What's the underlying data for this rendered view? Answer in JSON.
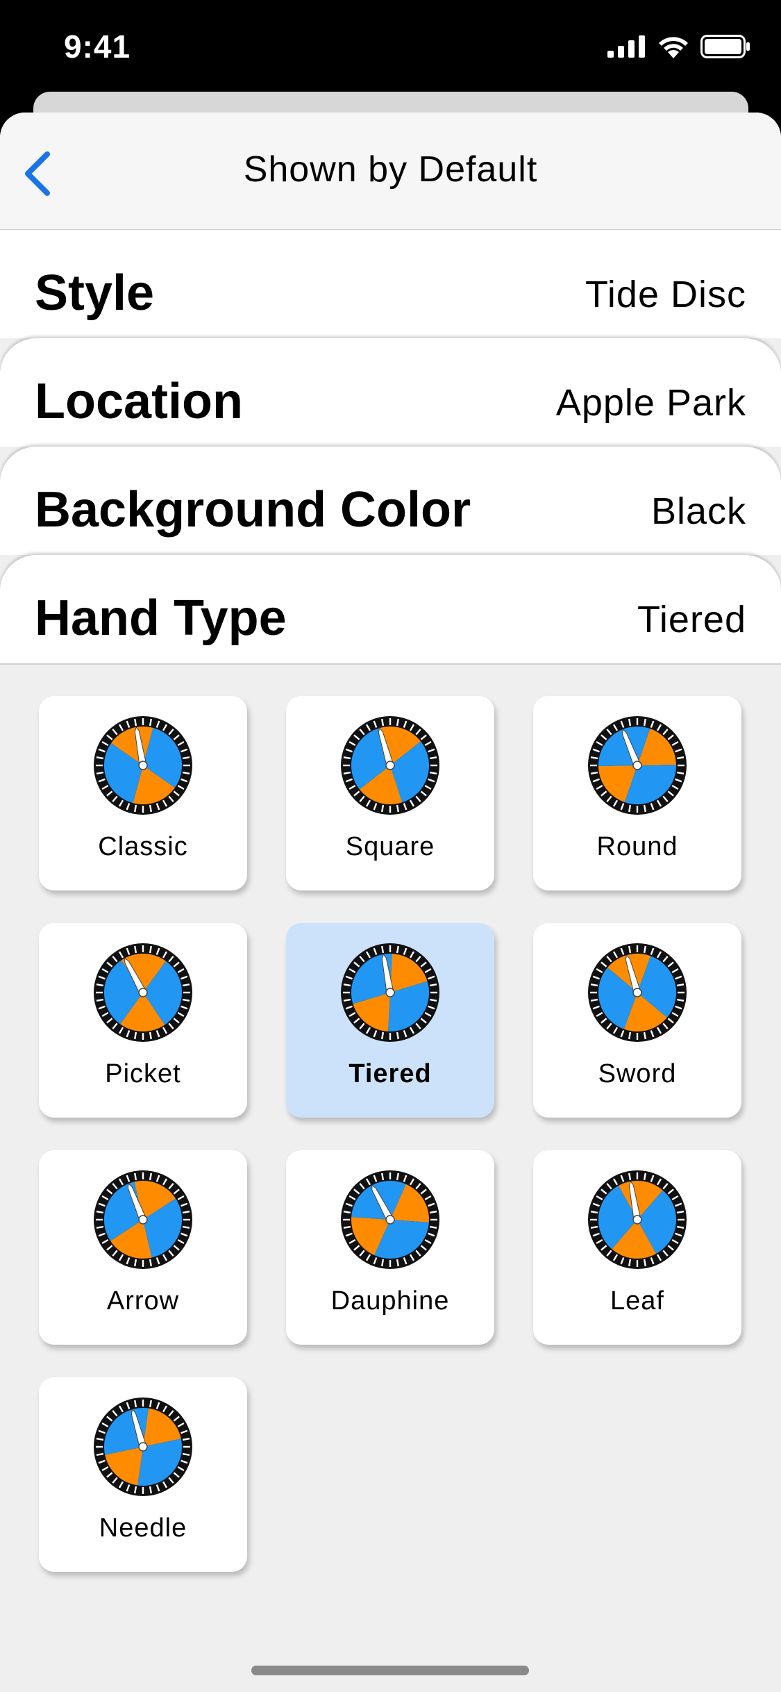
{
  "status": {
    "time": "9:41"
  },
  "nav": {
    "title": "Shown by Default"
  },
  "settings": [
    {
      "label": "Style",
      "value": "Tide Disc"
    },
    {
      "label": "Location",
      "value": "Apple Park"
    },
    {
      "label": "Background Color",
      "value": "Black"
    },
    {
      "label": "Hand Type",
      "value": "Tiered"
    }
  ],
  "hand_types": [
    {
      "label": "Classic"
    },
    {
      "label": "Square"
    },
    {
      "label": "Round"
    },
    {
      "label": "Picket"
    },
    {
      "label": "Tiered",
      "selected": true
    },
    {
      "label": "Sword"
    },
    {
      "label": "Arrow"
    },
    {
      "label": "Dauphine"
    },
    {
      "label": "Leaf"
    },
    {
      "label": "Needle"
    }
  ],
  "colors": {
    "accent": "#1a73e8",
    "selected_tile": "#cce2fb",
    "dial_orange": "#ff8c00",
    "dial_blue": "#2196f3"
  }
}
